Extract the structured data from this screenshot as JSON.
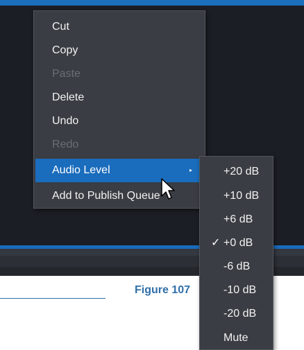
{
  "context_menu": {
    "items": [
      {
        "label": "Cut",
        "enabled": true
      },
      {
        "label": "Copy",
        "enabled": true
      },
      {
        "label": "Paste",
        "enabled": false
      },
      {
        "label": "Delete",
        "enabled": true
      },
      {
        "label": "Undo",
        "enabled": true
      },
      {
        "label": "Redo",
        "enabled": false
      },
      {
        "label": "Audio Level",
        "enabled": true,
        "highlighted": true,
        "has_submenu": true
      },
      {
        "label": "Add to Publish Queue",
        "enabled": true
      }
    ],
    "submenu_arrow": "▸"
  },
  "audio_level_submenu": {
    "items": [
      {
        "label": "+20 dB"
      },
      {
        "label": "+10 dB"
      },
      {
        "label": "+6 dB"
      },
      {
        "label": "+0 dB",
        "checked": true
      },
      {
        "label": "-6 dB"
      },
      {
        "label": "-10 dB"
      },
      {
        "label": "-20 dB"
      },
      {
        "label": "Mute"
      }
    ],
    "check_mark": "✓"
  },
  "figure_caption": "Figure 107",
  "colors": {
    "highlight": "#1a6cbc",
    "menu_bg": "#3a3d43",
    "disabled_text": "#6a6e75",
    "caption": "#2f6fa8"
  },
  "icons": {
    "cursor": "arrow-pointer-icon"
  }
}
